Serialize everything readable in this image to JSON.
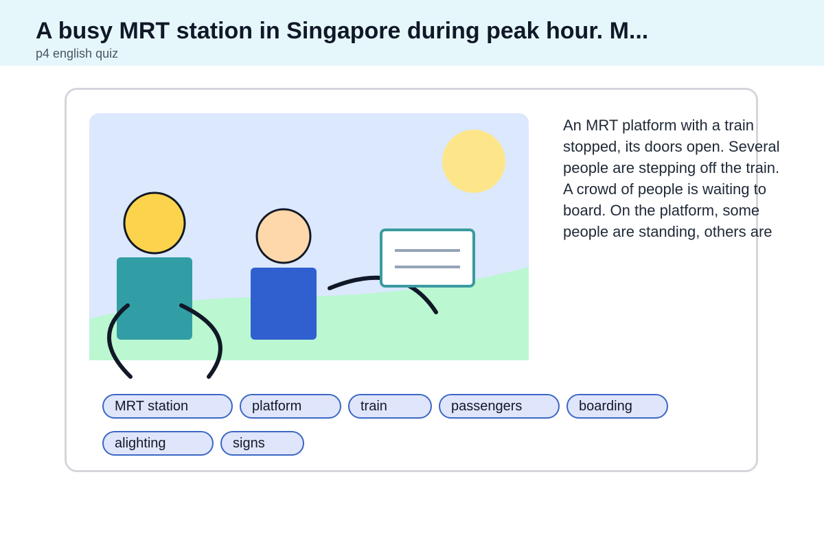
{
  "header": {
    "title": "A busy MRT station in Singapore during peak hour. M...",
    "subtitle": "p4 english quiz"
  },
  "illustration": {
    "sky_color": "#dbe8fd",
    "ground_color": "#bbf7d0",
    "sun_color": "#fde68a",
    "person_left_head_color": "#fcd34d",
    "person_left_body_color": "#319ea5",
    "person_right_head_color": "#fed7aa",
    "person_right_body_color": "#3060d0",
    "sign_border_color": "#3a9aa0"
  },
  "description": "An MRT platform with a train stopped, its doors open. Several people are stepping off the train. A crowd of people is waiting to board. On the platform, some people are standing, others are",
  "tags": [
    "MRT station",
    "platform",
    "train",
    "passengers",
    "boarding",
    "alighting",
    "signs"
  ]
}
